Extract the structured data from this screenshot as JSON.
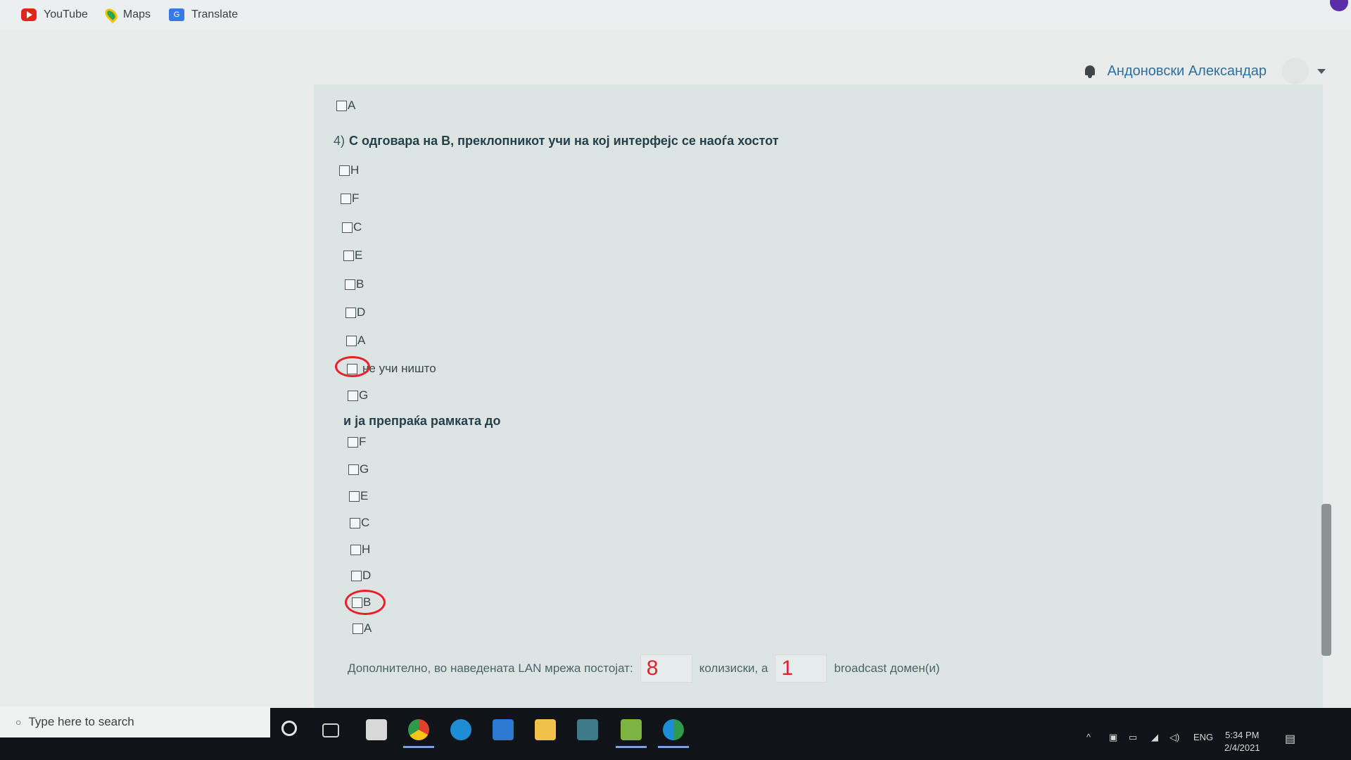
{
  "bookmarks": [
    {
      "label": "YouTube",
      "icon": "youtube-icon"
    },
    {
      "label": "Maps",
      "icon": "maps-icon"
    },
    {
      "label": "Translate",
      "icon": "translate-icon"
    }
  ],
  "header": {
    "user_name": "Андоновски Александар"
  },
  "quiz": {
    "prev_last_option": "A",
    "question_number": "4)",
    "question_text": "C одговара на B, преклопникот учи на кој интерфејс се наоѓа хостот",
    "learn_options": [
      "H",
      "F",
      "C",
      "E",
      "B",
      "D",
      "A",
      "не учи ништо",
      "G"
    ],
    "forward_label": "и ја препраќа рамката до",
    "forward_options": [
      "F",
      "G",
      "E",
      "C",
      "H",
      "D",
      "B",
      "A"
    ],
    "fill_prefix": "Дополнително, во наведената LAN мрежа постојат",
    "collision_value": "8",
    "fill_middle": "колизиски, а",
    "broadcast_value": "1",
    "fill_suffix": "broadcast домен(и)"
  },
  "taskbar": {
    "search_placeholder": "Type here to search",
    "language": "ENG",
    "time": "5:34 PM",
    "date": "2/4/2021"
  },
  "colors": {
    "annotation": "#e8202b",
    "panel": "#dde5e4",
    "accent_link": "#2d6f9d"
  }
}
